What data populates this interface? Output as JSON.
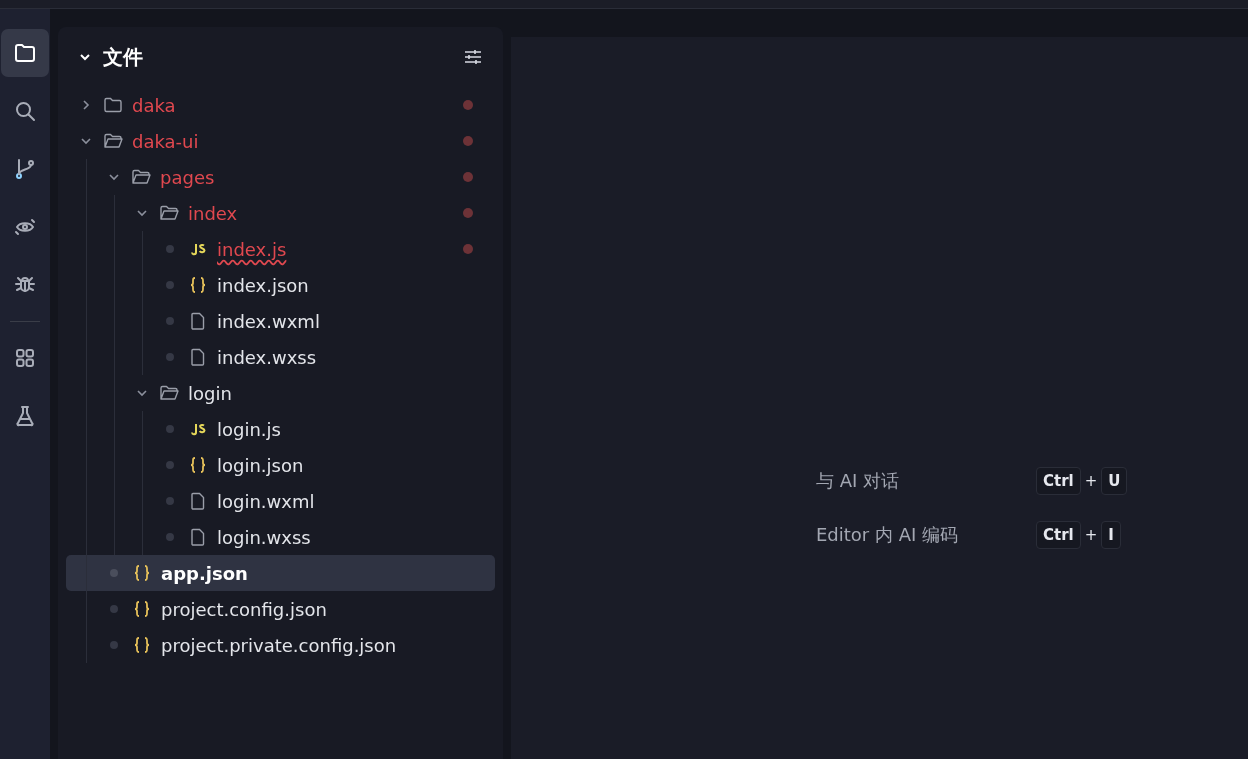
{
  "activity_bar": {
    "items": [
      {
        "kind": "files",
        "selected": true
      },
      {
        "kind": "search",
        "selected": false
      },
      {
        "kind": "branch",
        "selected": false
      },
      {
        "kind": "preview",
        "selected": false
      },
      {
        "kind": "debug",
        "selected": false
      },
      {
        "kind": "separator"
      },
      {
        "kind": "extensions",
        "selected": false
      },
      {
        "kind": "test",
        "selected": false
      }
    ]
  },
  "explorer": {
    "title": "文件",
    "expanded": true,
    "tree": [
      {
        "name": "daka",
        "kind": "folder",
        "expanded": false,
        "modified": true,
        "selected": false,
        "error": false
      },
      {
        "name": "daka-ui",
        "kind": "folder",
        "expanded": true,
        "modified": true,
        "selected": false,
        "error": false,
        "children": [
          {
            "name": "pages",
            "kind": "folder",
            "expanded": true,
            "modified": true,
            "selected": false,
            "error": false,
            "children": [
              {
                "name": "index",
                "kind": "folder",
                "expanded": true,
                "modified": true,
                "selected": false,
                "error": false,
                "children": [
                  {
                    "name": "index.js",
                    "kind": "js",
                    "modified": true,
                    "selected": false,
                    "error": true
                  },
                  {
                    "name": "index.json",
                    "kind": "json",
                    "modified": false,
                    "selected": false,
                    "error": false
                  },
                  {
                    "name": "index.wxml",
                    "kind": "file",
                    "modified": false,
                    "selected": false,
                    "error": false
                  },
                  {
                    "name": "index.wxss",
                    "kind": "file",
                    "modified": false,
                    "selected": false,
                    "error": false
                  }
                ]
              },
              {
                "name": "login",
                "kind": "folder",
                "expanded": true,
                "modified": false,
                "selected": false,
                "error": false,
                "children": [
                  {
                    "name": "login.js",
                    "kind": "js",
                    "modified": false,
                    "selected": false,
                    "error": false
                  },
                  {
                    "name": "login.json",
                    "kind": "json",
                    "modified": false,
                    "selected": false,
                    "error": false
                  },
                  {
                    "name": "login.wxml",
                    "kind": "file",
                    "modified": false,
                    "selected": false,
                    "error": false
                  },
                  {
                    "name": "login.wxss",
                    "kind": "file",
                    "modified": false,
                    "selected": false,
                    "error": false
                  }
                ]
              }
            ]
          },
          {
            "name": "app.json",
            "kind": "json",
            "modified": false,
            "selected": true,
            "error": false
          },
          {
            "name": "project.config.json",
            "kind": "json",
            "modified": false,
            "selected": false,
            "error": false
          },
          {
            "name": "project.private.config.json",
            "kind": "json",
            "modified": false,
            "selected": false,
            "error": false
          }
        ]
      }
    ]
  },
  "editor": {
    "shortcuts": [
      {
        "label": "与 AI 对话",
        "keys": [
          "Ctrl",
          "U"
        ],
        "joiner": "+"
      },
      {
        "label": "Editor 内 AI 编码",
        "keys": [
          "Ctrl",
          "I"
        ],
        "joiner": "+"
      }
    ]
  }
}
